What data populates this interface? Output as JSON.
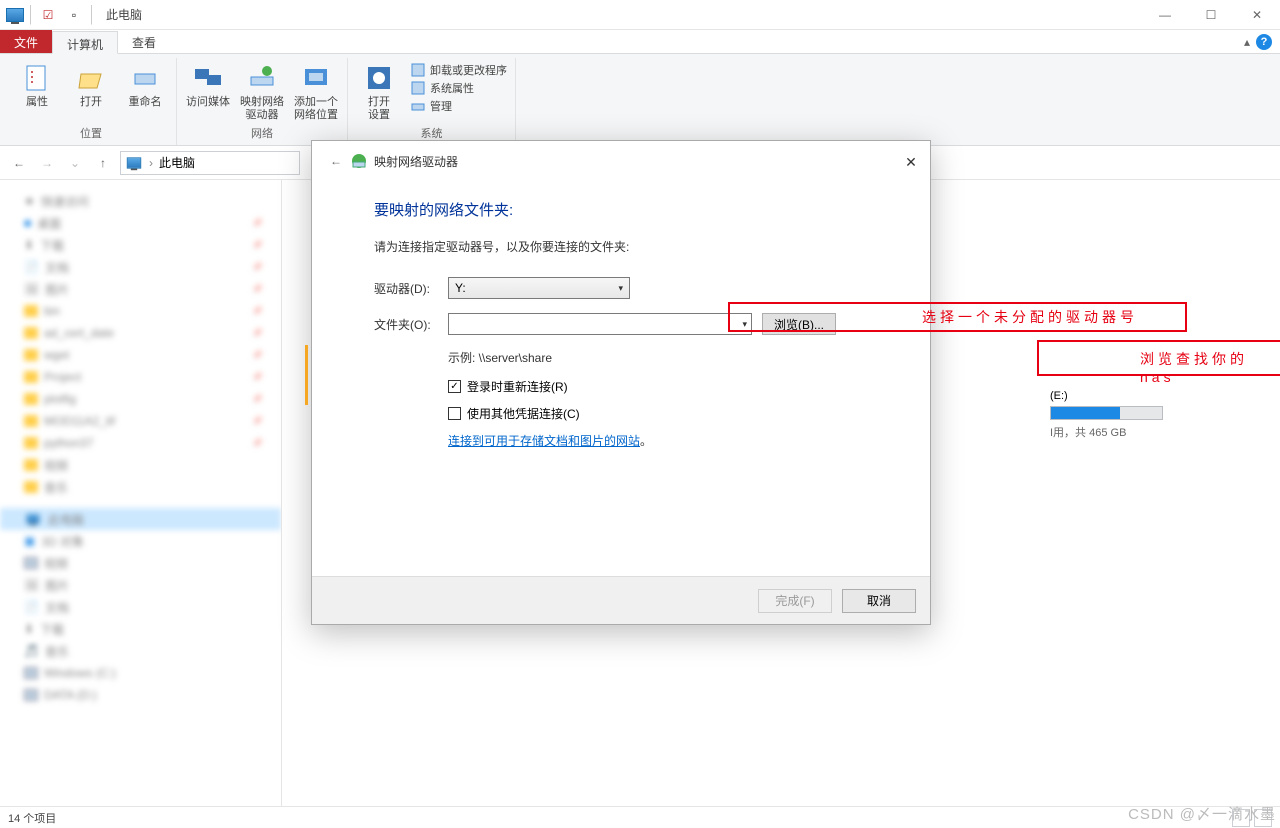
{
  "titlebar": {
    "title": "此电脑"
  },
  "window_buttons": {
    "min": "—",
    "max": "☐",
    "close": "✕"
  },
  "tabs": {
    "file": "文件",
    "computer": "计算机",
    "view": "查看",
    "collapse": "▴"
  },
  "ribbon": {
    "location_group": "位置",
    "network_group": "网络",
    "system_group": "系统",
    "properties": "属性",
    "open": "打开",
    "rename": "重命名",
    "access_media": "访问媒体",
    "map_drive": "映射网络\n驱动器",
    "add_location": "添加一个\n网络位置",
    "open_settings": "打开\n设置",
    "uninstall": "卸载或更改程序",
    "sys_props": "系统属性",
    "manage": "管理"
  },
  "breadcrumb": {
    "label": "此电脑"
  },
  "sidebar": {
    "items": [
      "快速访问",
      "桌面",
      "下载",
      "文档",
      "图片",
      "bin",
      "ad_cert_date",
      "wget",
      "Project",
      "plotfig",
      "MOD11A2_tif",
      "python37",
      "视频",
      "音乐",
      "此电脑",
      "3D 对象",
      "视频",
      "图片",
      "文档",
      "下载",
      "音乐",
      "Windows (C:)",
      "DATA (D:)"
    ]
  },
  "drive": {
    "label": "(E:)",
    "sub": "I用，共 465 GB",
    "fill_pct": 62
  },
  "dialog": {
    "title": "映射网络驱动器",
    "heading": "要映射的网络文件夹:",
    "desc": "请为连接指定驱动器号，以及你要连接的文件夹:",
    "drive_label": "驱动器(D):",
    "drive_value": "Y:",
    "folder_label": "文件夹(O):",
    "browse": "浏览(B)...",
    "example": "示例: \\\\server\\share",
    "cb_reconnect": "登录时重新连接(R)",
    "cb_othercred": "使用其他凭据连接(C)",
    "link": "连接到可用于存储文档和图片的网站",
    "finish": "完成(F)",
    "cancel": "取消"
  },
  "annotations": {
    "drive_hint": "选择一个未分配的驱动器号",
    "browse_hint": "浏览查找你的nas"
  },
  "status": {
    "items": "14 个项目"
  },
  "watermark": "CSDN @〆一滴水墨"
}
